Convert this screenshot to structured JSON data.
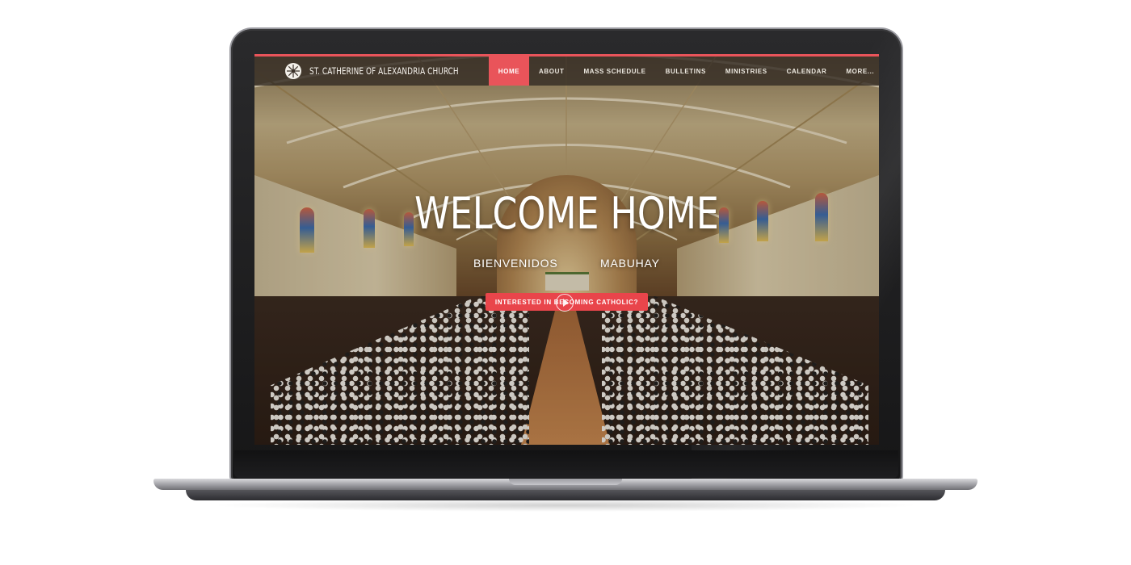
{
  "site": {
    "brand": "ST. CATHERINE OF ALEXANDRIA CHURCH",
    "logo_icon": "rose-window-icon"
  },
  "nav": {
    "items": [
      {
        "label": "HOME",
        "active": true
      },
      {
        "label": "ABOUT"
      },
      {
        "label": "MASS SCHEDULE"
      },
      {
        "label": "BULLETINS"
      },
      {
        "label": "MINISTRIES"
      },
      {
        "label": "CALENDAR"
      },
      {
        "label": "MORE..."
      }
    ]
  },
  "hero": {
    "title": "WELCOME HOME",
    "greetings": [
      "BIENVENIDOS",
      "MABUHAY"
    ],
    "cta_label": "INTERESTED IN BECOMING CATHOLIC?",
    "play_icon": "play-circle-icon"
  },
  "colors": {
    "accent": "#e9545a",
    "navbar": "#342c24",
    "laptop_body": "#1e1e20",
    "laptop_base": "#a8a8ad"
  }
}
